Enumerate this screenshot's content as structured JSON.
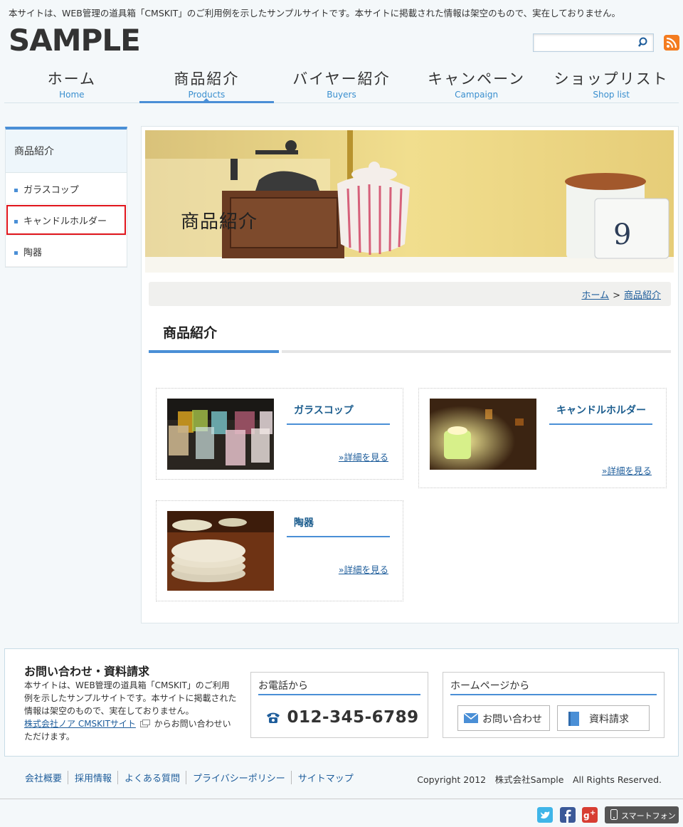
{
  "site": {
    "notice": "本サイトは、WEB管理の道具箱「CMSKIT」のご利用例を示したサンプルサイトです。本サイトに掲載された情報は架空のもので、実在しておりません。",
    "logo": "SAMPLE",
    "search_placeholder": ""
  },
  "gnav": [
    {
      "jp": "ホーム",
      "en": "Home"
    },
    {
      "jp": "商品紹介",
      "en": "Products"
    },
    {
      "jp": "バイヤー紹介",
      "en": "Buyers"
    },
    {
      "jp": "キャンペーン",
      "en": "Campaign"
    },
    {
      "jp": "ショップリスト",
      "en": "Shop list"
    }
  ],
  "sidebar": {
    "heading": "商品紹介",
    "items": [
      "ガラスコップ",
      "キャンドルホルダー",
      "陶器"
    ]
  },
  "main": {
    "hero_title": "商品紹介",
    "breadcrumb": {
      "home": "ホーム",
      "sep": ">",
      "current": "商品紹介"
    },
    "page_title": "商品紹介",
    "cards": [
      {
        "title": "ガラスコップ",
        "more": "»詳細を見る"
      },
      {
        "title": "キャンドルホルダー",
        "more": "»詳細を見る"
      },
      {
        "title": "陶器",
        "more": "»詳細を見る"
      }
    ]
  },
  "footer": {
    "contact_title": "お問い合わせ・資料請求",
    "contact_text": "本サイトは、WEB管理の道具箱「CMSKIT」のご利用例を示したサンプルサイトです。本サイトに掲載された情報は架空のもので、実在しておりません。",
    "contact_link": "株式会社ノア CMSKITサイト",
    "contact_text_after": "からお問い合わせいただけます。",
    "phone_heading": "お電話から",
    "phone": "012-345-6789",
    "web_heading": "ホームページから",
    "inquiry_button": "お問い合わせ",
    "document_button": "資料請求",
    "links": [
      "会社概要",
      "採用情報",
      "よくある質問",
      "プライバシーポリシー",
      "サイトマップ"
    ],
    "copyright": "Copyright 2012　株式会社Sample　All Rights Reserved.",
    "smartphone": "スマートフォン"
  },
  "icons": {
    "search": "search-icon",
    "rss": "rss-icon",
    "phone": "phone-icon",
    "mail": "mail-icon",
    "book": "book-icon",
    "twitter": "twitter-icon",
    "facebook": "facebook-icon",
    "googleplus": "google-plus-icon",
    "smartphone": "smartphone-icon"
  },
  "colors": {
    "accent": "#4a8fd6",
    "link": "#1e5d9b",
    "highlight": "#e0151c",
    "rss": "#f47c20"
  }
}
